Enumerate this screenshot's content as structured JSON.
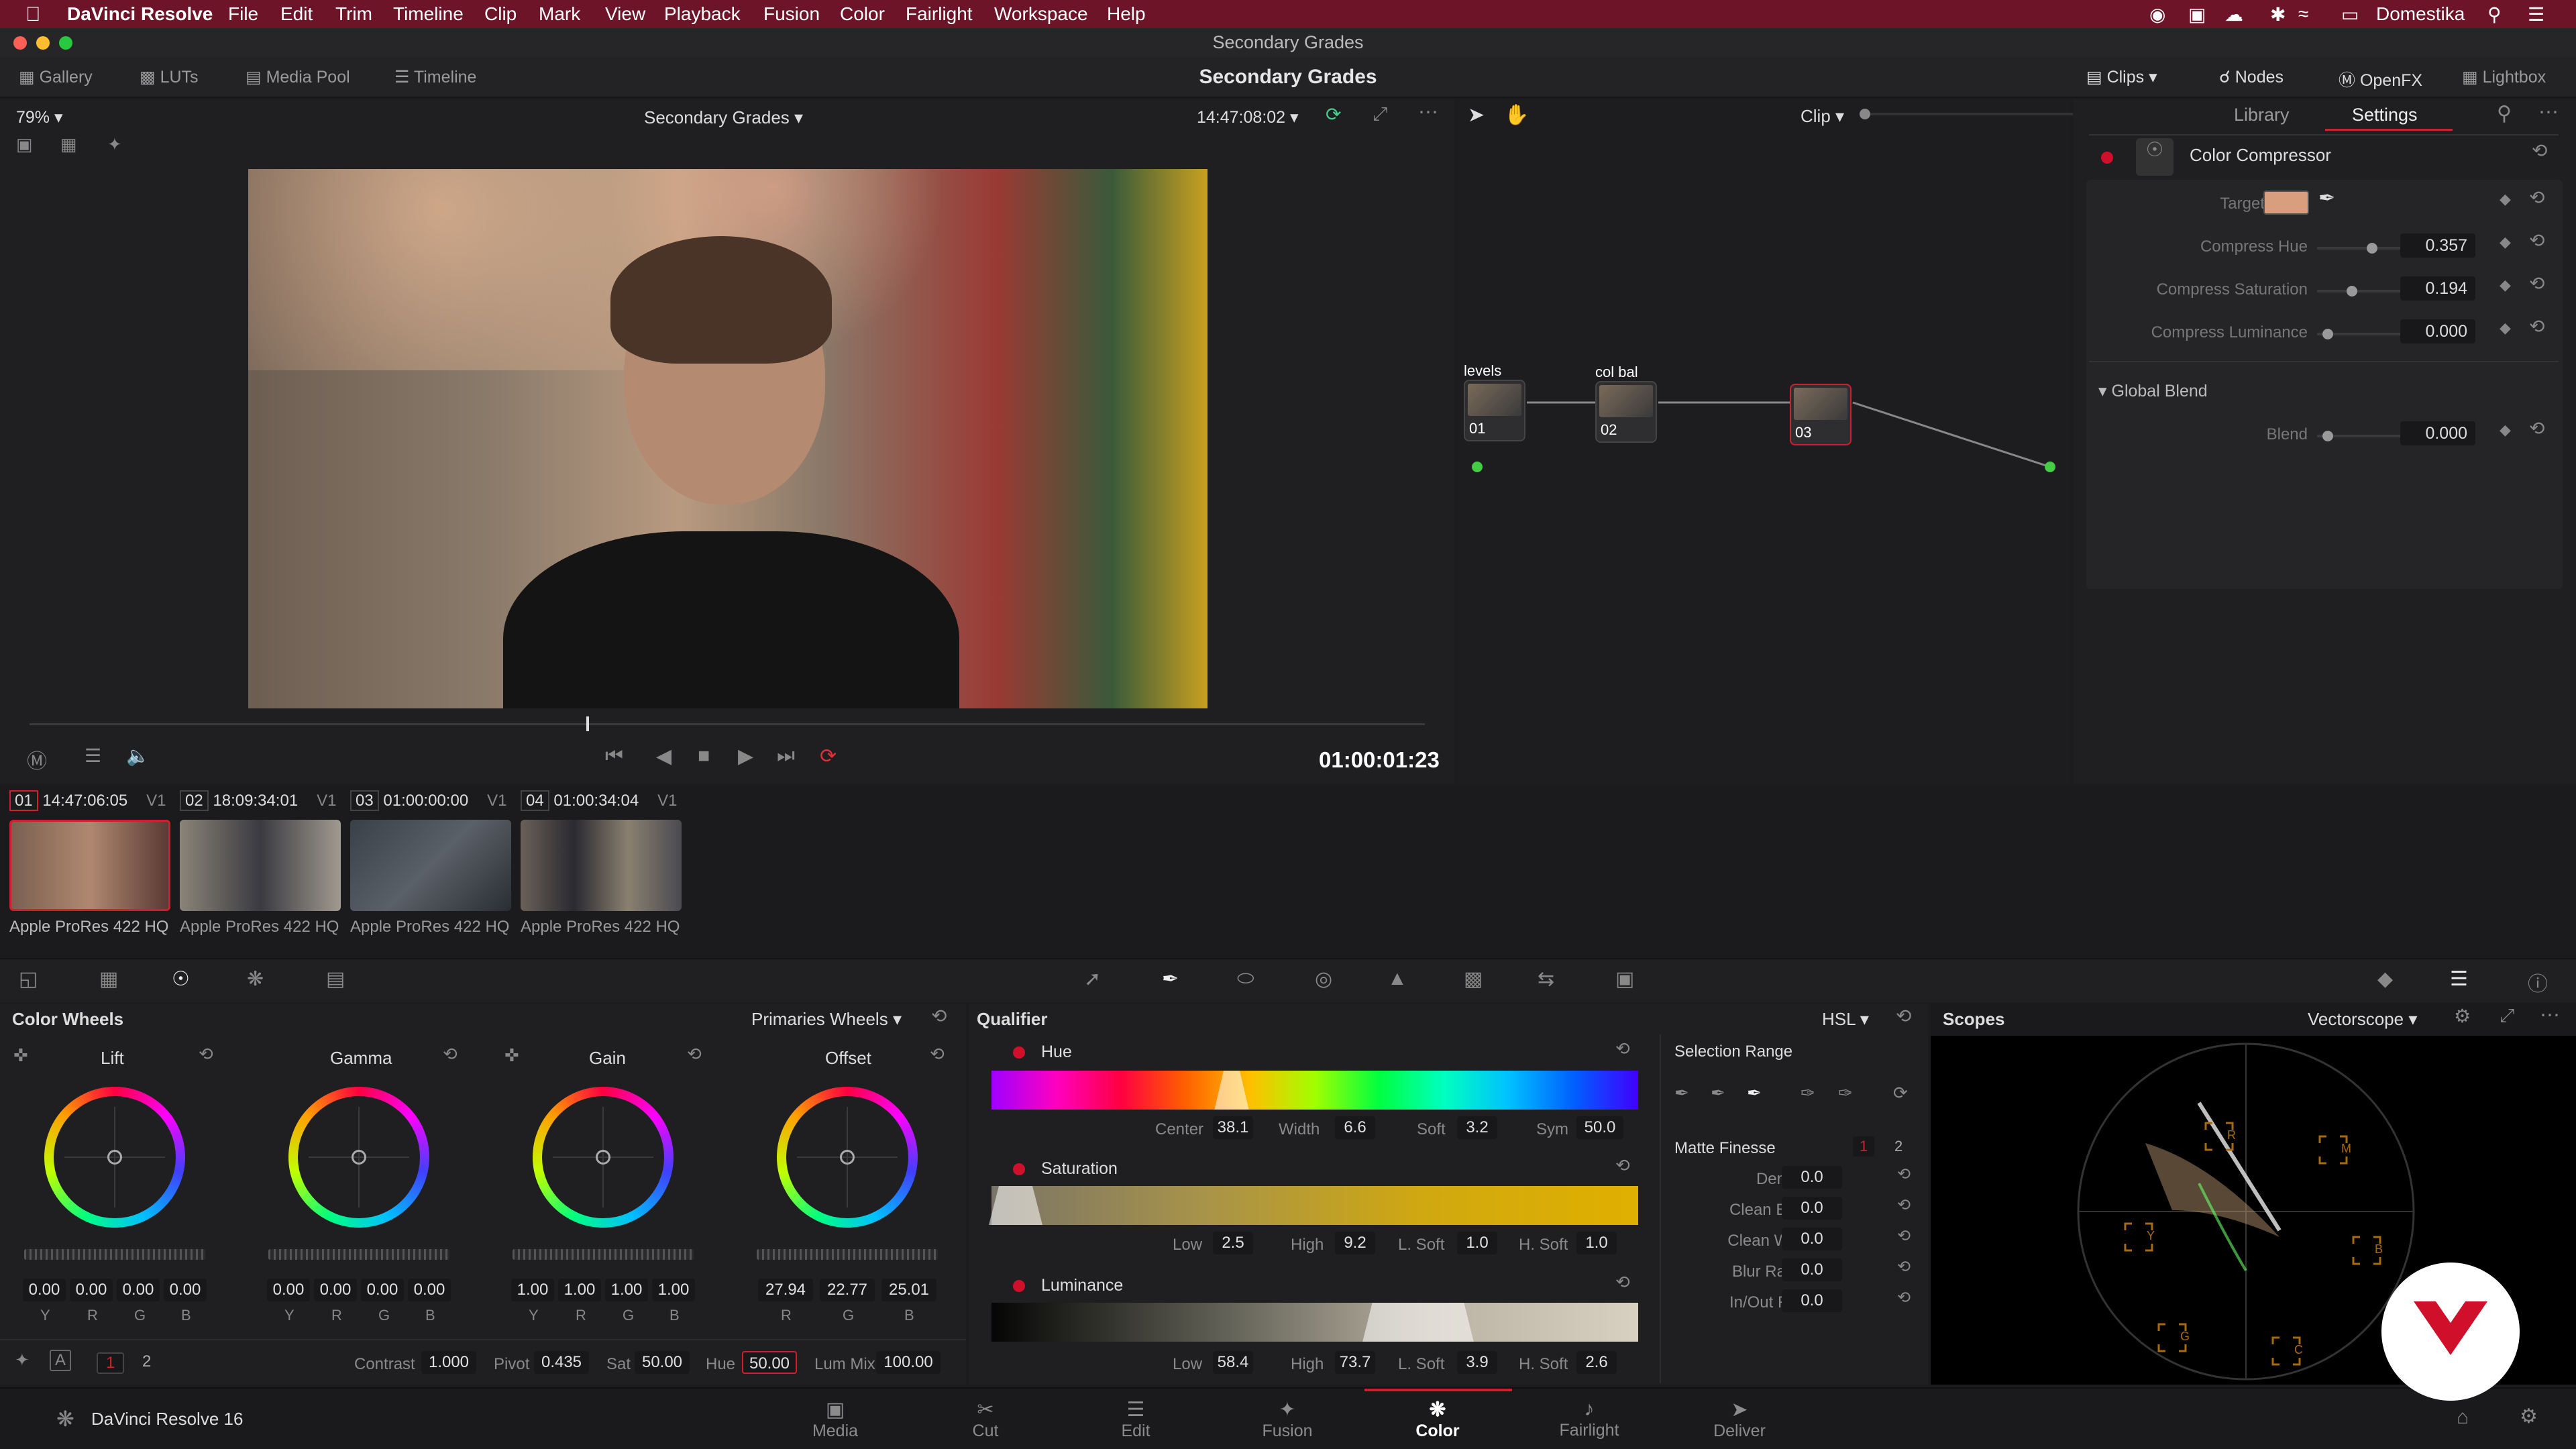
{
  "menubar": {
    "apple": "",
    "app": "DaVinci Resolve",
    "items": [
      "File",
      "Edit",
      "Trim",
      "Timeline",
      "Clip",
      "Mark",
      "View",
      "Playback",
      "Fusion",
      "Color",
      "Fairlight",
      "Workspace",
      "Help"
    ],
    "user": "Domestika"
  },
  "window_title": "Secondary Grades",
  "toolbar": {
    "gallery": "Gallery",
    "luts": "LUTs",
    "media_pool": "Media Pool",
    "timeline": "Timeline",
    "project_title": "Secondary Grades",
    "clips": "Clips",
    "nodes": "Nodes",
    "openfx": "OpenFX",
    "lightbox": "Lightbox"
  },
  "viewer": {
    "zoom": "79%",
    "timeline_name": "Secondary Grades",
    "source_tc": "14:47:08:02",
    "timecode": "01:00:01:23"
  },
  "node_editor": {
    "mode": "Clip",
    "nodes": [
      {
        "label": "levels",
        "num": "01"
      },
      {
        "label": "col bal",
        "num": "02"
      },
      {
        "label": "",
        "num": "03"
      }
    ]
  },
  "settings_panel": {
    "tabs": [
      "Library",
      "Settings"
    ],
    "effect": "Color Compressor",
    "target_color_label": "Target Color",
    "target_color": "#d89e7e",
    "params": [
      {
        "label": "Compress Hue",
        "value": "0.357",
        "level": 0.357
      },
      {
        "label": "Compress Saturation",
        "value": "0.194",
        "level": 0.194
      },
      {
        "label": "Compress Luminance",
        "value": "0.000",
        "level": 0
      }
    ],
    "global_blend": "Global Blend",
    "blend_label": "Blend",
    "blend_value": "0.000"
  },
  "clips": [
    {
      "num": "01",
      "tc": "14:47:06:05",
      "track": "V1",
      "codec": "Apple ProRes 422 HQ"
    },
    {
      "num": "02",
      "tc": "18:09:34:01",
      "track": "V1",
      "codec": "Apple ProRes 422 HQ"
    },
    {
      "num": "03",
      "tc": "01:00:00:00",
      "track": "V1",
      "codec": "Apple ProRes 422 HQ"
    },
    {
      "num": "04",
      "tc": "01:00:34:04",
      "track": "V1",
      "codec": "Apple ProRes 422 HQ"
    }
  ],
  "color_wheels": {
    "title": "Color Wheels",
    "mode": "Primaries Wheels",
    "wheels": [
      {
        "name": "Lift",
        "values": [
          "0.00",
          "0.00",
          "0.00",
          "0.00"
        ],
        "labels": [
          "Y",
          "R",
          "G",
          "B"
        ]
      },
      {
        "name": "Gamma",
        "values": [
          "0.00",
          "0.00",
          "0.00",
          "0.00"
        ],
        "labels": [
          "Y",
          "R",
          "G",
          "B"
        ]
      },
      {
        "name": "Gain",
        "values": [
          "1.00",
          "1.00",
          "1.00",
          "1.00"
        ],
        "labels": [
          "Y",
          "R",
          "G",
          "B"
        ]
      },
      {
        "name": "Offset",
        "values": [
          "27.94",
          "22.77",
          "25.01"
        ],
        "labels": [
          "R",
          "G",
          "B"
        ]
      }
    ],
    "bottom": {
      "page1": "1",
      "page2": "2",
      "contrast_label": "Contrast",
      "contrast": "1.000",
      "pivot_label": "Pivot",
      "pivot": "0.435",
      "sat_label": "Sat",
      "sat": "50.00",
      "hue_label": "Hue",
      "hue": "50.00",
      "lummix_label": "Lum Mix",
      "lummix": "100.00"
    }
  },
  "qualifier": {
    "title": "Qualifier",
    "mode": "HSL",
    "hue": {
      "label": "Hue",
      "center_label": "Center",
      "center": "38.1",
      "width_label": "Width",
      "width": "6.6",
      "soft_label": "Soft",
      "soft": "3.2",
      "sym_label": "Sym",
      "sym": "50.0"
    },
    "saturation": {
      "label": "Saturation",
      "low_label": "Low",
      "low": "2.5",
      "high_label": "High",
      "high": "9.2",
      "lsoft_label": "L. Soft",
      "lsoft": "1.0",
      "hsoft_label": "H. Soft",
      "hsoft": "1.0"
    },
    "luminance": {
      "label": "Luminance",
      "low_label": "Low",
      "low": "58.4",
      "high_label": "High",
      "high": "73.7",
      "lsoft_label": "L. Soft",
      "lsoft": "3.9",
      "hsoft_label": "H. Soft",
      "hsoft": "2.6"
    },
    "selection_range": "Selection Range",
    "matte_finesse": "Matte Finesse",
    "mf_page1": "1",
    "mf_page2": "2",
    "matte": [
      {
        "label": "Denoise",
        "value": "0.0"
      },
      {
        "label": "Clean Black",
        "value": "0.0"
      },
      {
        "label": "Clean White",
        "value": "0.0"
      },
      {
        "label": "Blur Radius",
        "value": "0.0"
      },
      {
        "label": "In/Out Ratio",
        "value": "0.0"
      }
    ]
  },
  "scopes": {
    "title": "Scopes",
    "mode": "Vectorscope",
    "targets": [
      "R",
      "M",
      "B",
      "C",
      "G",
      "Y"
    ]
  },
  "footer": {
    "app_version": "DaVinci Resolve 16",
    "pages": [
      "Media",
      "Cut",
      "Edit",
      "Fusion",
      "Color",
      "Fairlight",
      "Deliver"
    ],
    "active": "Color"
  }
}
